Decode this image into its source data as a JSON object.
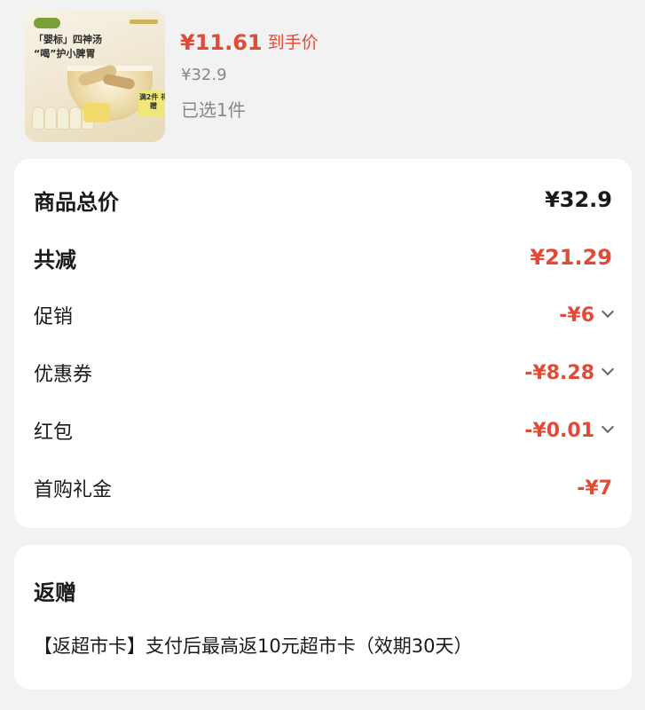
{
  "product": {
    "image_text_line1": "「婴标」四神汤",
    "image_text_line2": "“喝”护小脾胃",
    "image_gift_tag": "满2件 礼赠",
    "price_now": "¥11.61",
    "price_now_tag": "到手价",
    "price_original": "¥32.9",
    "selected_count": "已选1件"
  },
  "breakdown": {
    "rows": [
      {
        "label": "商品总价",
        "value": "¥32.9"
      },
      {
        "label": "共减",
        "value": "¥21.29"
      },
      {
        "label": "促销",
        "value": "-¥6"
      },
      {
        "label": "优惠券",
        "value": "-¥8.28"
      },
      {
        "label": "红包",
        "value": "-¥0.01"
      },
      {
        "label": "首购礼金",
        "value": "-¥7"
      }
    ]
  },
  "gift": {
    "title": "返赠",
    "text": "【返超市卡】支付后最高返10元超市卡（效期30天）"
  },
  "colors": {
    "accent_red": "#e24a36",
    "text_dark": "#1a1a1a",
    "text_gray": "#888888",
    "background": "#f2f2f2",
    "card": "#ffffff"
  }
}
